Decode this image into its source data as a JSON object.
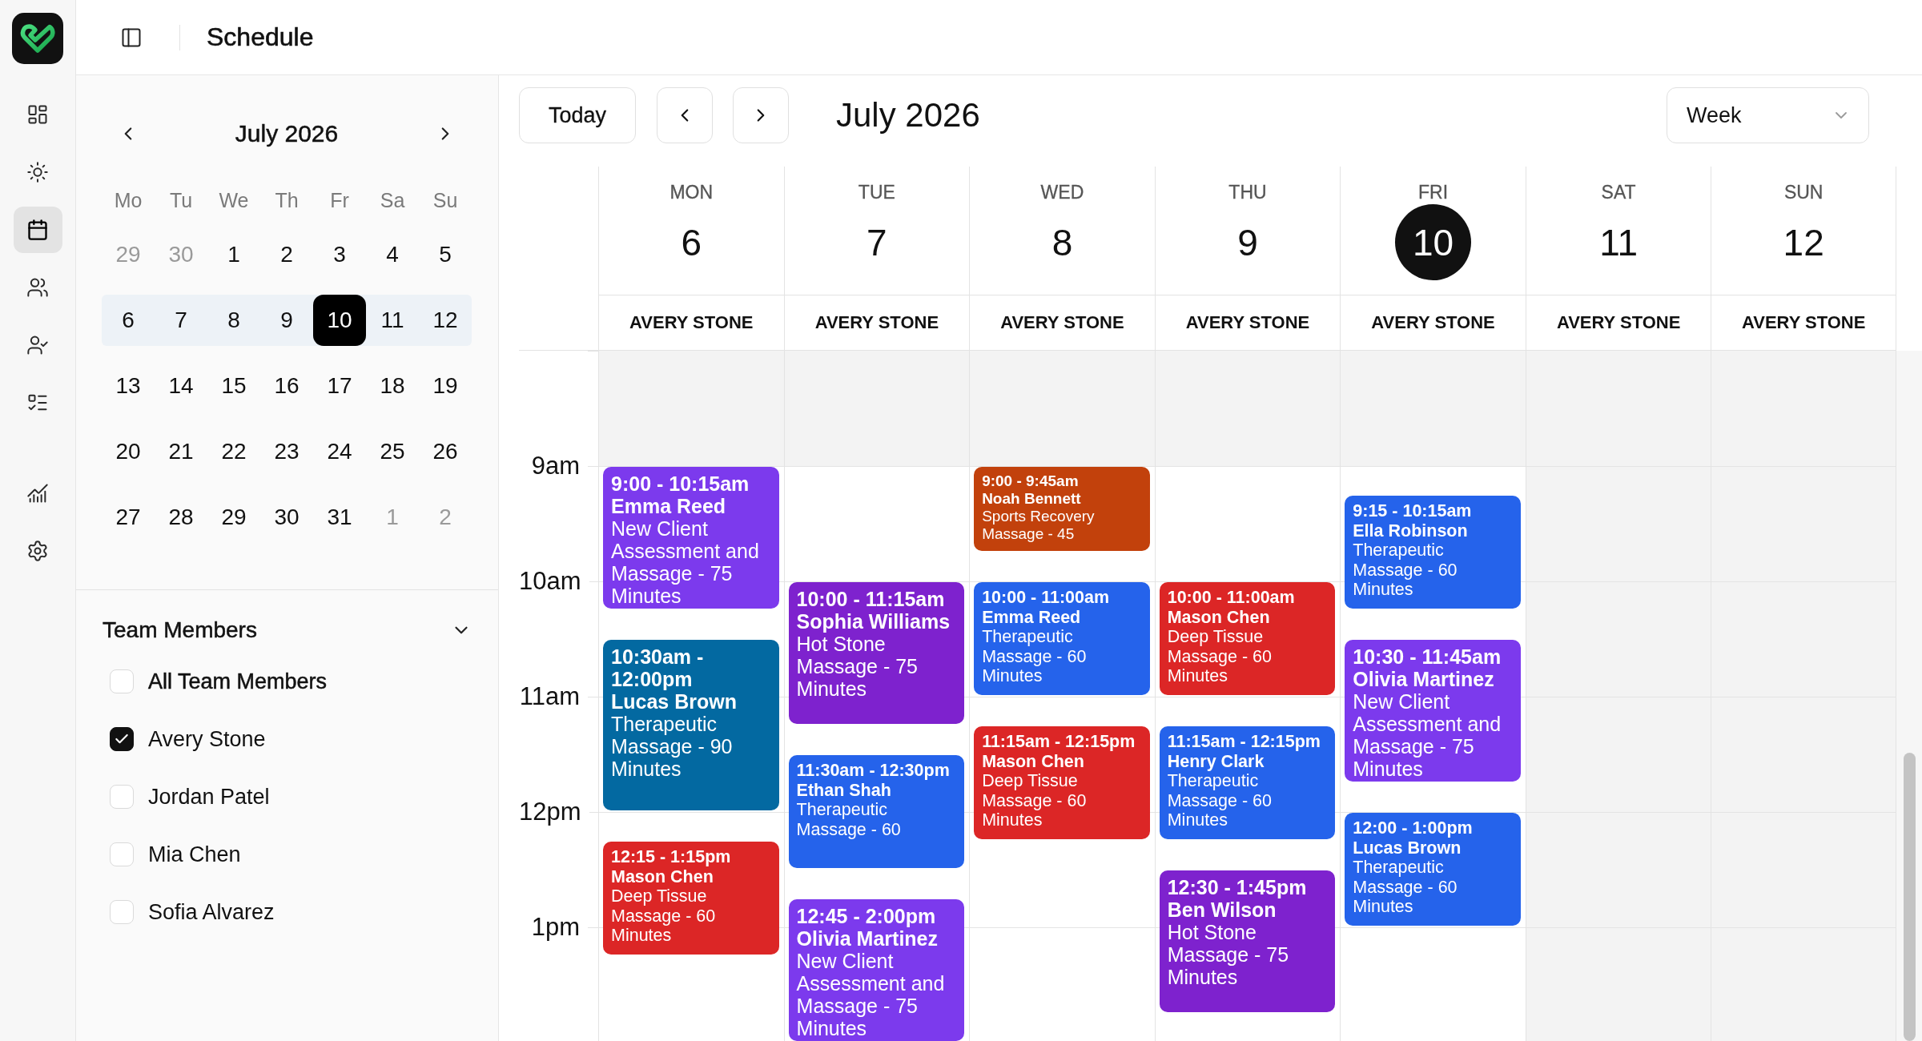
{
  "rail": {
    "main_items": [
      {
        "kind": "dashboard",
        "selected": false
      },
      {
        "kind": "today",
        "selected": false
      },
      {
        "kind": "schedule",
        "selected": true
      },
      {
        "kind": "clients",
        "selected": false
      },
      {
        "kind": "staff",
        "selected": false
      },
      {
        "kind": "tasks",
        "selected": false
      }
    ],
    "tool_items": [
      {
        "kind": "reports",
        "selected": false
      },
      {
        "kind": "settings",
        "selected": false
      }
    ]
  },
  "header": {
    "title": "Schedule"
  },
  "mini_calendar": {
    "month": "July 2026",
    "weekdays": [
      "Mo",
      "Tu",
      "We",
      "Th",
      "Fr",
      "Sa",
      "Su"
    ],
    "weeks": [
      {
        "selected": false,
        "days": [
          {
            "label": "29",
            "muted": true,
            "selected": false
          },
          {
            "label": "30",
            "muted": true,
            "selected": false
          },
          {
            "label": "1",
            "muted": false,
            "selected": false
          },
          {
            "label": "2",
            "muted": false,
            "selected": false
          },
          {
            "label": "3",
            "muted": false,
            "selected": false
          },
          {
            "label": "4",
            "muted": false,
            "selected": false
          },
          {
            "label": "5",
            "muted": false,
            "selected": false
          }
        ]
      },
      {
        "selected": true,
        "days": [
          {
            "label": "6",
            "muted": false,
            "selected": false
          },
          {
            "label": "7",
            "muted": false,
            "selected": false
          },
          {
            "label": "8",
            "muted": false,
            "selected": false
          },
          {
            "label": "9",
            "muted": false,
            "selected": false
          },
          {
            "label": "10",
            "muted": false,
            "selected": true
          },
          {
            "label": "11",
            "muted": false,
            "selected": false
          },
          {
            "label": "12",
            "muted": false,
            "selected": false
          }
        ]
      },
      {
        "selected": false,
        "days": [
          {
            "label": "13",
            "muted": false,
            "selected": false
          },
          {
            "label": "14",
            "muted": false,
            "selected": false
          },
          {
            "label": "15",
            "muted": false,
            "selected": false
          },
          {
            "label": "16",
            "muted": false,
            "selected": false
          },
          {
            "label": "17",
            "muted": false,
            "selected": false
          },
          {
            "label": "18",
            "muted": false,
            "selected": false
          },
          {
            "label": "19",
            "muted": false,
            "selected": false
          }
        ]
      },
      {
        "selected": false,
        "days": [
          {
            "label": "20",
            "muted": false,
            "selected": false
          },
          {
            "label": "21",
            "muted": false,
            "selected": false
          },
          {
            "label": "22",
            "muted": false,
            "selected": false
          },
          {
            "label": "23",
            "muted": false,
            "selected": false
          },
          {
            "label": "24",
            "muted": false,
            "selected": false
          },
          {
            "label": "25",
            "muted": false,
            "selected": false
          },
          {
            "label": "26",
            "muted": false,
            "selected": false
          }
        ]
      },
      {
        "selected": false,
        "days": [
          {
            "label": "27",
            "muted": false,
            "selected": false
          },
          {
            "label": "28",
            "muted": false,
            "selected": false
          },
          {
            "label": "29",
            "muted": false,
            "selected": false
          },
          {
            "label": "30",
            "muted": false,
            "selected": false
          },
          {
            "label": "31",
            "muted": false,
            "selected": false
          },
          {
            "label": "1",
            "muted": true,
            "selected": false
          },
          {
            "label": "2",
            "muted": true,
            "selected": false
          }
        ]
      }
    ]
  },
  "team": {
    "title": "Team Members",
    "expanded": true,
    "all": {
      "label": "All Team Members",
      "checked": false
    },
    "members": [
      {
        "name": "Avery Stone",
        "checked": true
      },
      {
        "name": "Jordan Patel",
        "checked": false
      },
      {
        "name": "Mia Chen",
        "checked": false
      },
      {
        "name": "Sofia Alvarez",
        "checked": false
      }
    ]
  },
  "toolbar": {
    "today_button": "Today",
    "title": "July 2026",
    "view": "Week"
  },
  "calendar": {
    "hours": [
      {
        "available": false
      },
      {
        "label": "9am",
        "available": true
      },
      {
        "label": "10am",
        "available": true
      },
      {
        "label": "11am",
        "available": true
      },
      {
        "label": "12pm",
        "available": true
      },
      {
        "label": "1pm",
        "available": true
      }
    ],
    "days": [
      {
        "weekday": "MON",
        "date": "6",
        "selected": false,
        "available": true,
        "resource": "AVERY STONE",
        "events": [
          {
            "time": "9:00 - 10:15am",
            "client": "Emma Reed",
            "service": "New Client Assessment and Massage - 75 Minutes",
            "color": "#7c3aed"
          },
          {
            "time": "10:30am - 12:00pm",
            "client": "Lucas Brown",
            "service": "Therapeutic Massage - 90 Minutes",
            "color": "#0369a1"
          },
          {
            "time": "12:15 - 1:15pm",
            "client": "Mason Chen",
            "service": "Deep Tissue Massage - 60 Minutes",
            "color": "#dc2626"
          }
        ]
      },
      {
        "weekday": "TUE",
        "date": "7",
        "selected": false,
        "available": true,
        "resource": "AVERY STONE",
        "events": [
          {
            "time": "10:00 - 11:15am",
            "client": "Sophia Williams",
            "service": "Hot Stone Massage - 75 Minutes",
            "color": "#7e22ce"
          },
          {
            "time": "11:30am - 12:30pm",
            "client": "Ethan Shah",
            "service": "Therapeutic Massage - 60",
            "color": "#2563eb"
          },
          {
            "time": "12:45 - 2:00pm",
            "client": "Olivia Martinez",
            "service": "New Client Assessment and Massage - 75 Minutes",
            "color": "#7c3aed"
          }
        ]
      },
      {
        "weekday": "WED",
        "date": "8",
        "selected": false,
        "available": true,
        "resource": "AVERY STONE",
        "events": [
          {
            "time": "9:00 - 9:45am",
            "client": "Noah Bennett",
            "service": "Sports Recovery Massage - 45",
            "color": "#c2410c"
          },
          {
            "time": "10:00 - 11:00am",
            "client": "Emma Reed",
            "service": "Therapeutic Massage - 60 Minutes",
            "color": "#2563eb"
          },
          {
            "time": "11:15am - 12:15pm",
            "client": "Mason Chen",
            "service": "Deep Tissue Massage - 60 Minutes",
            "color": "#dc2626"
          }
        ]
      },
      {
        "weekday": "THU",
        "date": "9",
        "selected": false,
        "available": true,
        "resource": "AVERY STONE",
        "events": [
          {
            "time": "10:00 - 11:00am",
            "client": "Mason Chen",
            "service": "Deep Tissue Massage - 60 Minutes",
            "color": "#dc2626"
          },
          {
            "time": "11:15am - 12:15pm",
            "client": "Henry Clark",
            "service": "Therapeutic Massage - 60 Minutes",
            "color": "#2563eb"
          },
          {
            "time": "12:30 - 1:45pm",
            "client": "Ben Wilson",
            "service": "Hot Stone Massage - 75 Minutes",
            "color": "#7e22ce"
          }
        ]
      },
      {
        "weekday": "FRI",
        "date": "10",
        "selected": true,
        "available": true,
        "resource": "AVERY STONE",
        "events": [
          {
            "time": "9:15 - 10:15am",
            "client": "Ella Robinson",
            "service": "Therapeutic Massage - 60 Minutes",
            "color": "#2563eb"
          },
          {
            "time": "10:30 - 11:45am",
            "client": "Olivia Martinez",
            "service": "New Client Assessment and Massage - 75 Minutes",
            "color": "#7c3aed"
          },
          {
            "time": "12:00 - 1:00pm",
            "client": "Lucas Brown",
            "service": "Therapeutic Massage - 60 Minutes",
            "color": "#2563eb"
          }
        ]
      },
      {
        "weekday": "SAT",
        "date": "11",
        "selected": false,
        "available": false,
        "resource": "AVERY STONE"
      },
      {
        "weekday": "SUN",
        "date": "12",
        "selected": false,
        "available": false,
        "resource": "AVERY STONE"
      }
    ]
  }
}
